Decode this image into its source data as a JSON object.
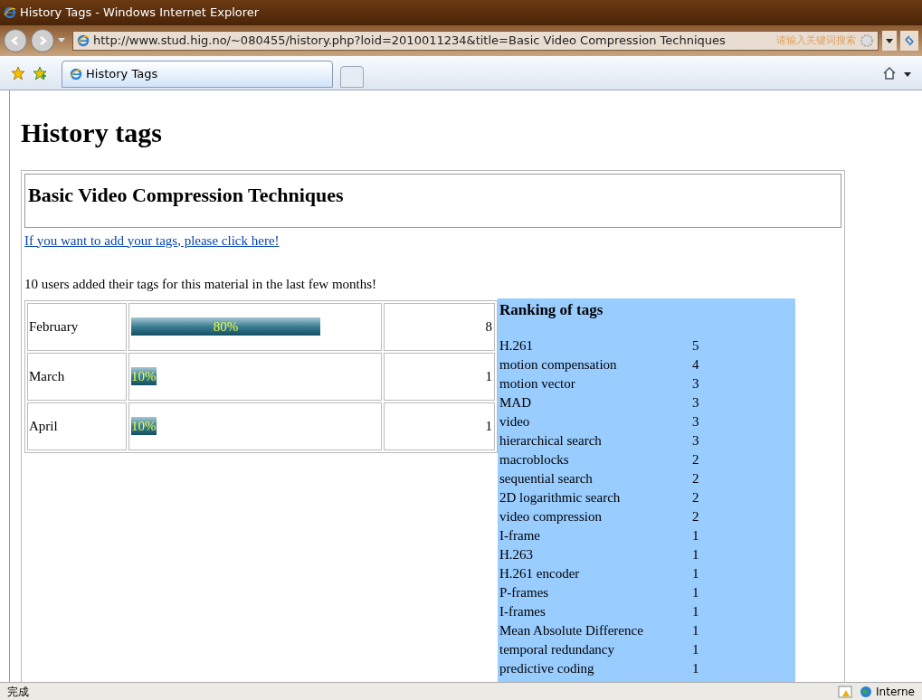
{
  "window": {
    "title": "History Tags - Windows Internet Explorer"
  },
  "address_bar": {
    "url": "http://www.stud.hig.no/~080455/history.php?loid=2010011234&title=Basic Video Compression Techniques",
    "search_placeholder": "请输入关键词搜索"
  },
  "tabs": [
    {
      "label": "History Tags",
      "selected": true
    }
  ],
  "page": {
    "heading": "History tags",
    "material_title": "Basic Video Compression Techniques",
    "add_link": "If you want to add your tags, please click here!",
    "summary": "10 users added their tags for this material in the last few months!",
    "months": [
      {
        "month": "February",
        "percent": "80%",
        "level": 0.8,
        "count": "8"
      },
      {
        "month": "March",
        "percent": "10%",
        "level": 0.1,
        "count": "1"
      },
      {
        "month": "April",
        "percent": "10%",
        "level": 0.1,
        "count": "1"
      }
    ],
    "ranking": {
      "title": "Ranking of tags",
      "tags": [
        {
          "tag": "H.261",
          "count": "5"
        },
        {
          "tag": "motion compensation",
          "count": "4"
        },
        {
          "tag": "motion vector",
          "count": "3"
        },
        {
          "tag": "MAD",
          "count": "3"
        },
        {
          "tag": "video",
          "count": "3"
        },
        {
          "tag": "hierarchical search",
          "count": "3"
        },
        {
          "tag": "macroblocks",
          "count": "2"
        },
        {
          "tag": "sequential search",
          "count": "2"
        },
        {
          "tag": "2D logarithmic search",
          "count": "2"
        },
        {
          "tag": "video compression",
          "count": "2"
        },
        {
          "tag": "I-frame",
          "count": "1"
        },
        {
          "tag": "H.263",
          "count": "1"
        },
        {
          "tag": "H.261 encoder",
          "count": "1"
        },
        {
          "tag": "P-frames",
          "count": "1"
        },
        {
          "tag": "I-frames",
          "count": "1"
        },
        {
          "tag": "Mean Absolute Difference",
          "count": "1"
        },
        {
          "tag": "temporal redundancy",
          "count": "1"
        },
        {
          "tag": "predictive coding",
          "count": "1"
        }
      ]
    }
  },
  "status_bar": {
    "text": "完成",
    "zone": "Interne"
  }
}
